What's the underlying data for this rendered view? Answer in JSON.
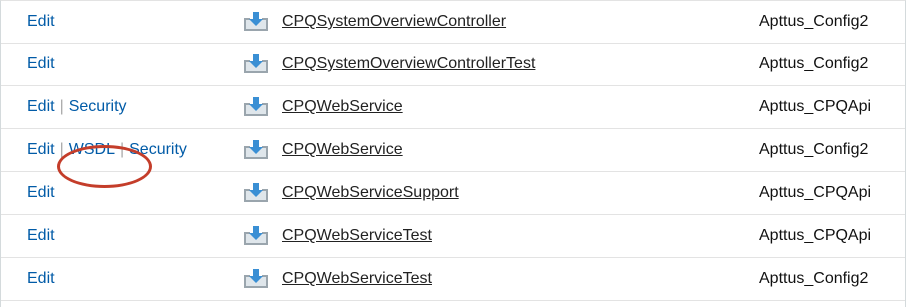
{
  "rows": [
    {
      "actions": [
        {
          "name": "edit-link",
          "label": "Edit"
        }
      ],
      "name": "CPQSystemOverviewController",
      "namespace": "Apttus_Config2"
    },
    {
      "actions": [
        {
          "name": "edit-link",
          "label": "Edit"
        }
      ],
      "name": "CPQSystemOverviewControllerTest",
      "namespace": "Apttus_Config2"
    },
    {
      "actions": [
        {
          "name": "edit-link",
          "label": "Edit"
        },
        {
          "name": "security-link",
          "label": "Security"
        }
      ],
      "name": "CPQWebService",
      "namespace": "Apttus_CPQApi"
    },
    {
      "actions": [
        {
          "name": "edit-link",
          "label": "Edit"
        },
        {
          "name": "wsdl-link",
          "label": "WSDL"
        },
        {
          "name": "security-link",
          "label": "Security"
        }
      ],
      "name": "CPQWebService",
      "namespace": "Apttus_Config2"
    },
    {
      "actions": [
        {
          "name": "edit-link",
          "label": "Edit"
        }
      ],
      "name": "CPQWebServiceSupport",
      "namespace": "Apttus_CPQApi"
    },
    {
      "actions": [
        {
          "name": "edit-link",
          "label": "Edit"
        }
      ],
      "name": "CPQWebServiceTest",
      "namespace": "Apttus_CPQApi"
    },
    {
      "actions": [
        {
          "name": "edit-link",
          "label": "Edit"
        }
      ],
      "name": "CPQWebServiceTest",
      "namespace": "Apttus_Config2"
    }
  ],
  "separator": "|",
  "icons": {
    "row_icon": "download-file-icon"
  },
  "colors": {
    "link": "#015ba7",
    "highlight": "#c43d2a"
  },
  "annotation": {
    "highlighted": "WSDL"
  }
}
